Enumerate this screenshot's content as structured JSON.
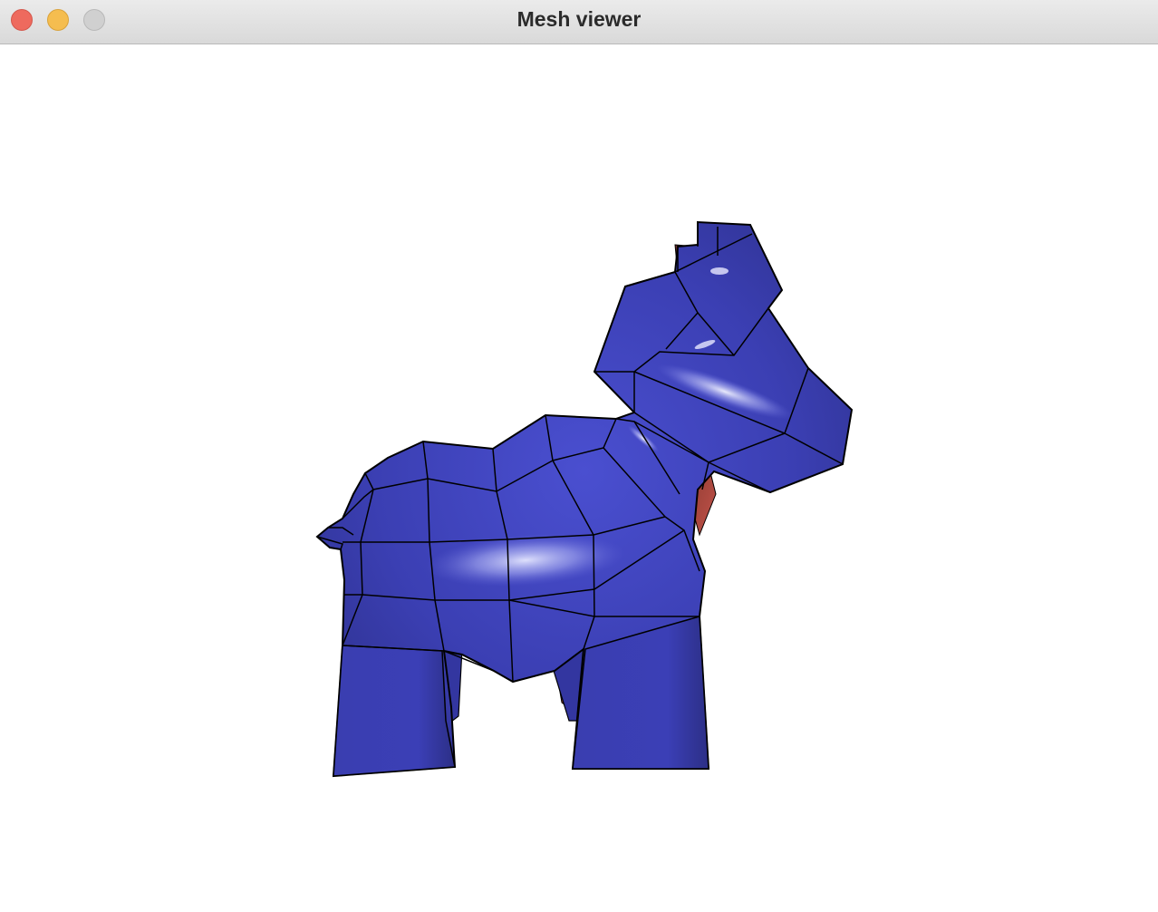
{
  "window": {
    "title": "Mesh viewer",
    "controls": {
      "close_icon": "close-icon",
      "minimize_icon": "minimize-icon",
      "zoom_icon": "zoom-icon"
    }
  },
  "viewport": {
    "model": "horse-quad-mesh",
    "colors": {
      "front_face": "#3b3fb3",
      "back_face": "#b0463a",
      "edges": "#000000",
      "background": "#ffffff"
    }
  }
}
